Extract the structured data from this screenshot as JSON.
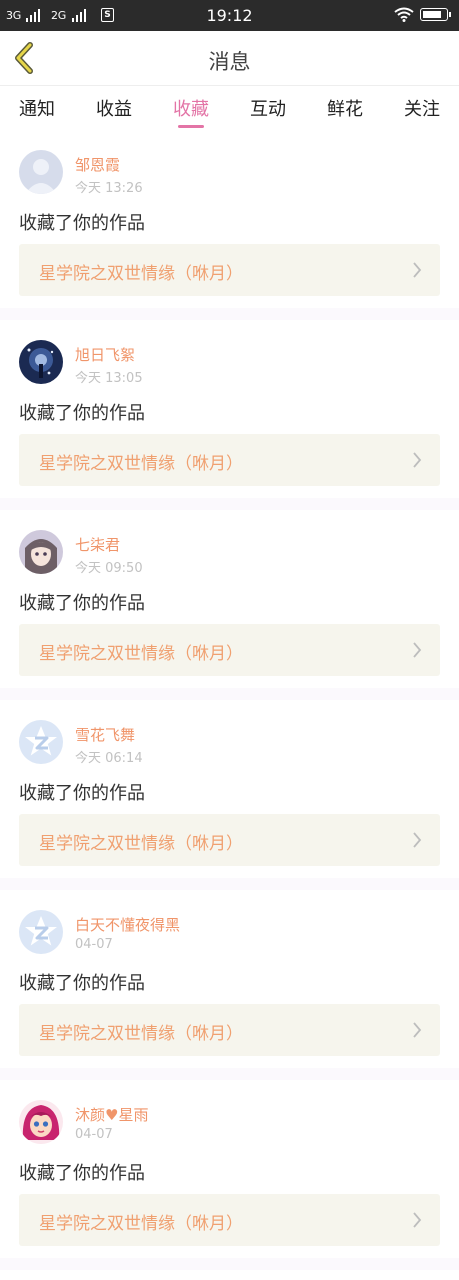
{
  "status_bar": {
    "signal1": "3G",
    "signal2": "2G",
    "s_icon": "S",
    "time": "19:12",
    "icons": [
      "signal-icon",
      "wifi-icon",
      "battery-icon"
    ]
  },
  "header": {
    "title": "消息",
    "back_icon": "chevron-left-icon"
  },
  "tabs": [
    {
      "label": "通知"
    },
    {
      "label": "收益"
    },
    {
      "label": "收藏"
    },
    {
      "label": "互动"
    },
    {
      "label": "鲜花"
    },
    {
      "label": "关注"
    }
  ],
  "active_tab": "收藏",
  "colors": {
    "accent": "#e374a6",
    "name": "#f0956a",
    "work_title": "#f0a070",
    "work_bg": "#f6f5ed",
    "status_bar": "#2b2b2b"
  },
  "messages": [
    {
      "user": "邹恩霞",
      "time": "今天 13:26",
      "action": "收藏了你的作品",
      "work": "星学院之双世情缘（咻月）",
      "avatar": "default-avatar-icon"
    },
    {
      "user": "旭日飞絮",
      "time": "今天 13:05",
      "action": "收藏了你的作品",
      "work": "星学院之双世情缘（咻月）",
      "avatar": "night-scene-avatar"
    },
    {
      "user": "七柒君",
      "time": "今天 09:50",
      "action": "收藏了你的作品",
      "work": "星学院之双世情缘（咻月）",
      "avatar": "anime-girl-avatar"
    },
    {
      "user": "雪花飞舞",
      "time": "今天 06:14",
      "action": "收藏了你的作品",
      "work": "星学院之双世情缘（咻月）",
      "avatar": "star-logo-avatar"
    },
    {
      "user": "白天不懂夜得黑",
      "time": "04-07",
      "action": "收藏了你的作品",
      "work": "星学院之双世情缘（咻月）",
      "avatar": "star-logo-avatar"
    },
    {
      "user": "沐颜♥星雨",
      "time": "04-07",
      "action": "收藏了你的作品",
      "work": "星学院之双世情缘（咻月）",
      "avatar": "pink-hair-girl-avatar"
    }
  ]
}
